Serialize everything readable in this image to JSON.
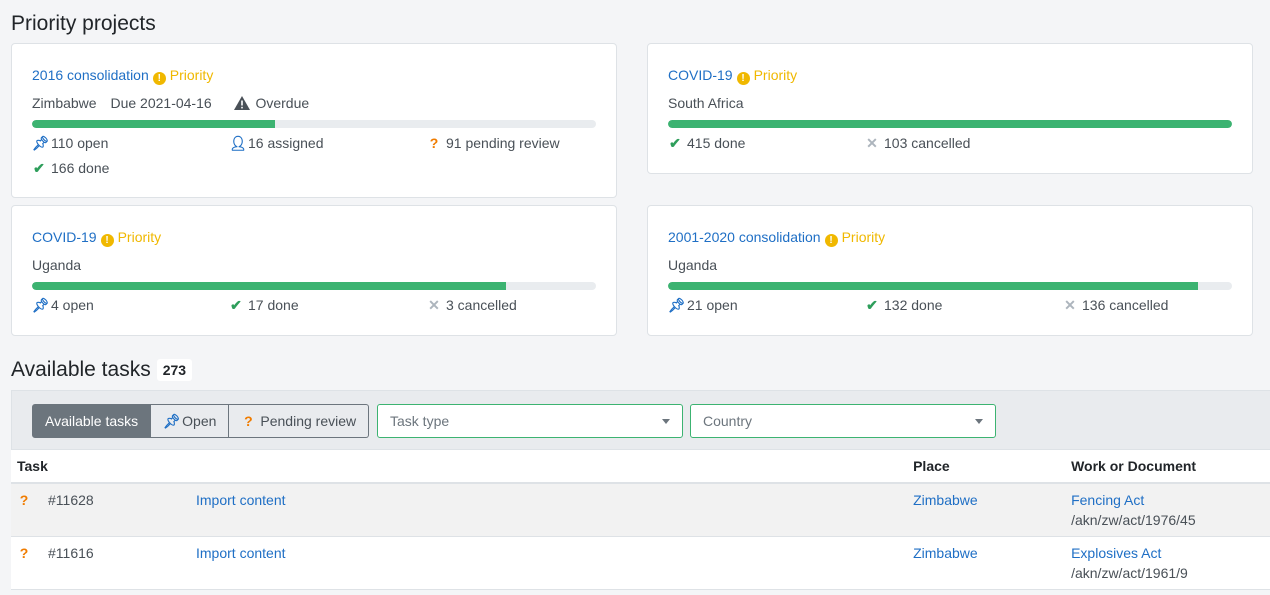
{
  "priority": {
    "heading": "Priority projects",
    "priority_label": "Priority",
    "cards": [
      {
        "title": "2016 consolidation",
        "place": "Zimbabwe",
        "due": "Due 2021-04-16",
        "overdue": "Overdue",
        "progress": 0.43,
        "stats": [
          "110 open",
          "16 assigned",
          "91 pending review",
          "166 done"
        ]
      },
      {
        "title": "COVID-19",
        "place": "South Africa",
        "progress": 1.0,
        "stats": [
          "415 done",
          "103 cancelled"
        ]
      },
      {
        "title": "COVID-19",
        "place": "Uganda",
        "progress": 0.84,
        "stats": [
          "4 open",
          "17 done",
          "3 cancelled"
        ]
      },
      {
        "title": "2001-2020 consolidation",
        "place": "Uganda",
        "progress": 0.94,
        "stats": [
          "21 open",
          "132 done",
          "136 cancelled"
        ]
      }
    ]
  },
  "tasks": {
    "heading": "Available tasks",
    "count": "273",
    "filters": {
      "available": "Available tasks",
      "open": "Open",
      "pending": "Pending review"
    },
    "task_type_placeholder": "Task type",
    "country_placeholder": "Country",
    "columns": [
      "Task",
      "Place",
      "Work or Document"
    ],
    "rows": [
      {
        "id": "#11628",
        "title": "Import content",
        "place": "Zimbabwe",
        "work": "Fencing Act",
        "frbr": "/akn/zw/act/1976/45"
      },
      {
        "id": "#11616",
        "title": "Import content",
        "place": "Zimbabwe",
        "work": "Explosives Act",
        "frbr": "/akn/zw/act/1961/9"
      }
    ]
  },
  "colors": {
    "link": "#1f6fc5",
    "priority": "#f0b800",
    "progress": "#3cb371",
    "pending": "#f07c00"
  },
  "icons": [
    "pin-icon",
    "user-check-icon",
    "question-icon",
    "check-icon",
    "cross-icon",
    "warning-icon",
    "priority-icon",
    "caret-down-icon"
  ]
}
